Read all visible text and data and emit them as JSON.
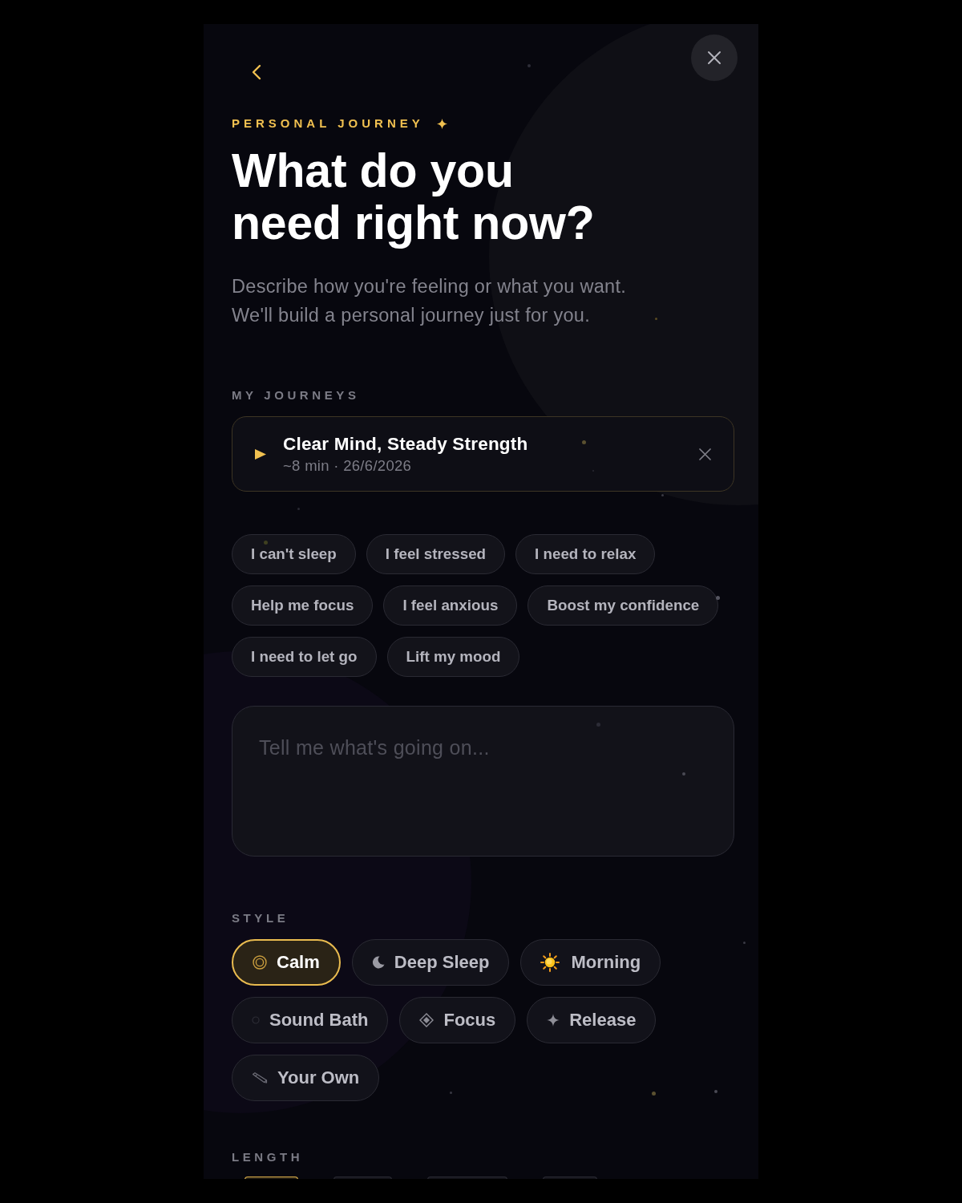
{
  "header": {
    "eyebrow": "PERSONAL JOURNEY",
    "title": "What do you\nneed right now?",
    "subtitle": "Describe how you're feeling or what you want.\nWe'll build a personal journey just for you."
  },
  "my_journeys": {
    "label": "MY JOURNEYS",
    "items": [
      {
        "title": "Clear Mind, Steady Strength",
        "meta": "~8 min · 26/6/2026"
      }
    ]
  },
  "suggestions": [
    "I can't sleep",
    "I feel stressed",
    "I need to relax",
    "Help me focus",
    "I feel anxious",
    "Boost my confidence",
    "I need to let go",
    "Lift my mood"
  ],
  "prompt": {
    "placeholder": "Tell me what's going on..."
  },
  "style": {
    "label": "STYLE",
    "options": [
      {
        "label": "Calm",
        "kind": "calm",
        "selected": true
      },
      {
        "label": "Deep Sleep",
        "kind": "sleep",
        "selected": false
      },
      {
        "label": "Morning",
        "kind": "morning",
        "selected": false
      },
      {
        "label": "Sound Bath",
        "kind": "sound",
        "selected": false
      },
      {
        "label": "Focus",
        "kind": "focus",
        "selected": false
      },
      {
        "label": "Release",
        "kind": "release",
        "selected": false
      },
      {
        "label": "Your Own",
        "kind": "custom",
        "selected": false
      }
    ]
  },
  "length": {
    "label": "LENGTH",
    "options": [
      {
        "selected": true
      },
      {
        "selected": false
      },
      {
        "selected": false
      },
      {
        "selected": false
      }
    ]
  }
}
